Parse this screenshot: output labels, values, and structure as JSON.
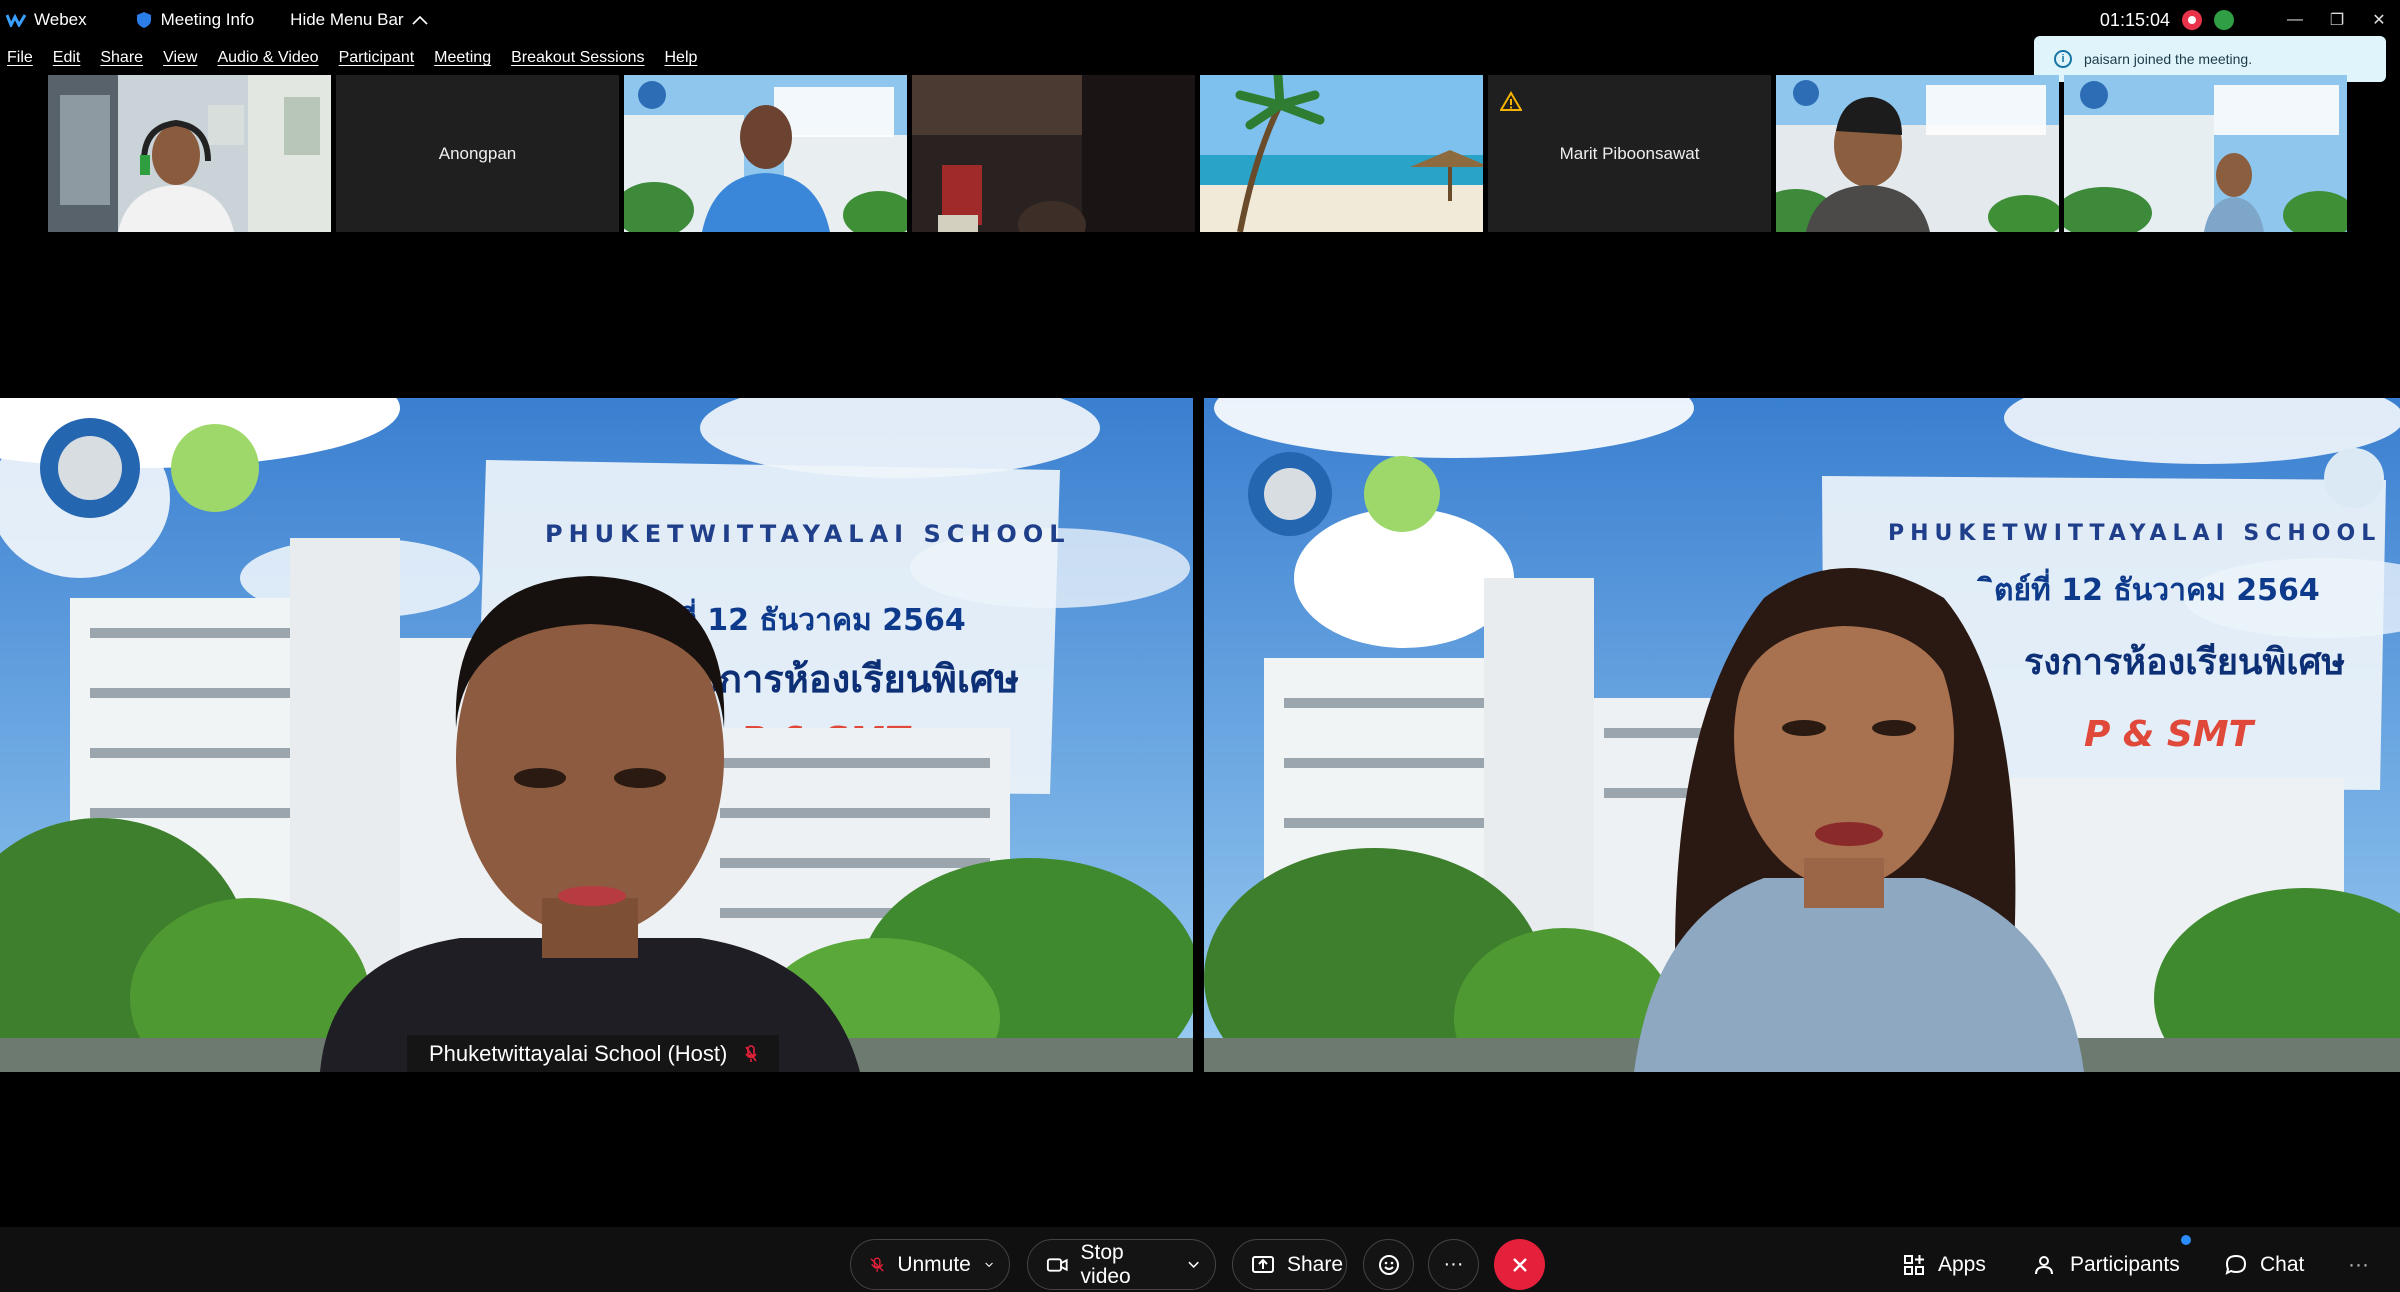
{
  "titlebar": {
    "app_name": "Webex",
    "meeting_info": "Meeting Info",
    "hide_menu": "Hide Menu Bar",
    "clock": "01:15:04"
  },
  "menu": [
    "File",
    "Edit",
    "Share",
    "View",
    "Audio & Video",
    "Participant",
    "Meeting",
    "Breakout Sessions",
    "Help"
  ],
  "toast": {
    "text": "paisarn joined the meeting."
  },
  "filmstrip": [
    {
      "type": "video",
      "scene": "man-headset"
    },
    {
      "type": "name",
      "name": "Anongpan"
    },
    {
      "type": "video",
      "scene": "man-blue-shirt-school"
    },
    {
      "type": "video",
      "scene": "dark-room"
    },
    {
      "type": "video",
      "scene": "beach"
    },
    {
      "type": "name",
      "name": "Marit Piboonsawat",
      "warning": true
    },
    {
      "type": "video",
      "scene": "man-school"
    },
    {
      "type": "video",
      "scene": "man-far-school"
    }
  ],
  "main_tiles": [
    {
      "banner_title": "PHUKETWITTAYALAI SCHOOL",
      "banner_date": "ิตย์ที่ 12 ธันวาคม 2564",
      "banner_line": "รงการห้องเรียนพิเศษ",
      "banner_short": "P & SMT",
      "host_label": "Phuketwittayalai School (Host)"
    },
    {
      "banner_title": "PHUKETWITTAYALAI SCHOOL",
      "banner_date": "ิตย์ที่ 12 ธันวาคม 2564",
      "banner_line": "รงการห้องเรียนพิเศษ",
      "banner_short": "P & SMT"
    }
  ],
  "controls": {
    "unmute": "Unmute",
    "stop_video": "Stop video",
    "share": "Share",
    "apps": "Apps",
    "participants": "Participants",
    "chat": "Chat"
  },
  "colors": {
    "end_call": "#e5203b",
    "toast_bg": "#dff5fb",
    "accent": "#2b8cff"
  }
}
